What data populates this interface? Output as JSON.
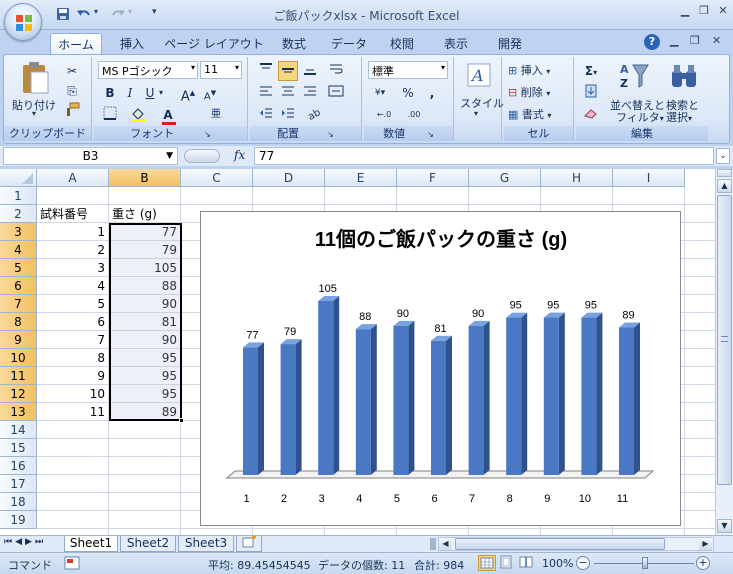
{
  "window": {
    "title": "ご飯パックxlsx - Microsoft Excel"
  },
  "ribbon_tabs": [
    "ホーム",
    "挿入",
    "ページ レイアウト",
    "数式",
    "データ",
    "校閲",
    "表示",
    "開発"
  ],
  "ribbon": {
    "clipboard": {
      "paste": "貼り付け",
      "label": "クリップボード"
    },
    "font": {
      "name": "MS Pゴシック",
      "size": "11",
      "label": "フォント"
    },
    "alignment": {
      "label": "配置"
    },
    "number": {
      "format": "標準",
      "label": "数値"
    },
    "styles": {
      "button": "スタイル"
    },
    "cells": {
      "insert": "挿入",
      "delete": "削除",
      "format": "書式",
      "label": "セル"
    },
    "editing": {
      "sort": "並べ替えと",
      "sort2": "フィルタ",
      "find": "検索と",
      "find2": "選択",
      "label": "編集"
    }
  },
  "formula_bar": {
    "name_box": "B3",
    "fx": "fx",
    "value": "77"
  },
  "columns": [
    "A",
    "B",
    "C",
    "D",
    "E",
    "F",
    "G",
    "H",
    "I"
  ],
  "rows": [
    "1",
    "2",
    "3",
    "4",
    "5",
    "6",
    "7",
    "8",
    "9",
    "10",
    "11",
    "12",
    "13",
    "14",
    "15",
    "16",
    "17",
    "18",
    "19"
  ],
  "table": {
    "header_a": "試料番号",
    "header_b": "重さ (g)",
    "ids": [
      "1",
      "2",
      "3",
      "4",
      "5",
      "6",
      "7",
      "8",
      "9",
      "10",
      "11"
    ],
    "weights": [
      "77",
      "79",
      "105",
      "88",
      "90",
      "81",
      "90",
      "95",
      "95",
      "95",
      "89"
    ]
  },
  "chart_data": {
    "type": "bar",
    "title": "11個のご飯パックの重さ (g)",
    "categories": [
      "1",
      "2",
      "3",
      "4",
      "5",
      "6",
      "7",
      "8",
      "9",
      "10",
      "11"
    ],
    "values": [
      77,
      79,
      105,
      88,
      90,
      81,
      90,
      95,
      95,
      95,
      89
    ],
    "data_labels": [
      "77",
      "79",
      "105",
      "88",
      "90",
      "81",
      "90",
      "95",
      "95",
      "95",
      "89"
    ],
    "bar_color": "#4a78c2",
    "legend": "none",
    "grid": false,
    "three_d": true
  },
  "sheets": [
    "Sheet1",
    "Sheet2",
    "Sheet3"
  ],
  "status": {
    "mode": "コマンド",
    "average": "平均: 89.45454545",
    "count": "データの個数: 11",
    "sum": "合計: 984",
    "zoom": "100%"
  },
  "colors": {
    "accent": "#4a78c2",
    "selected_header": "#f1c15f",
    "ribbon_bg": "#dde8f7"
  }
}
